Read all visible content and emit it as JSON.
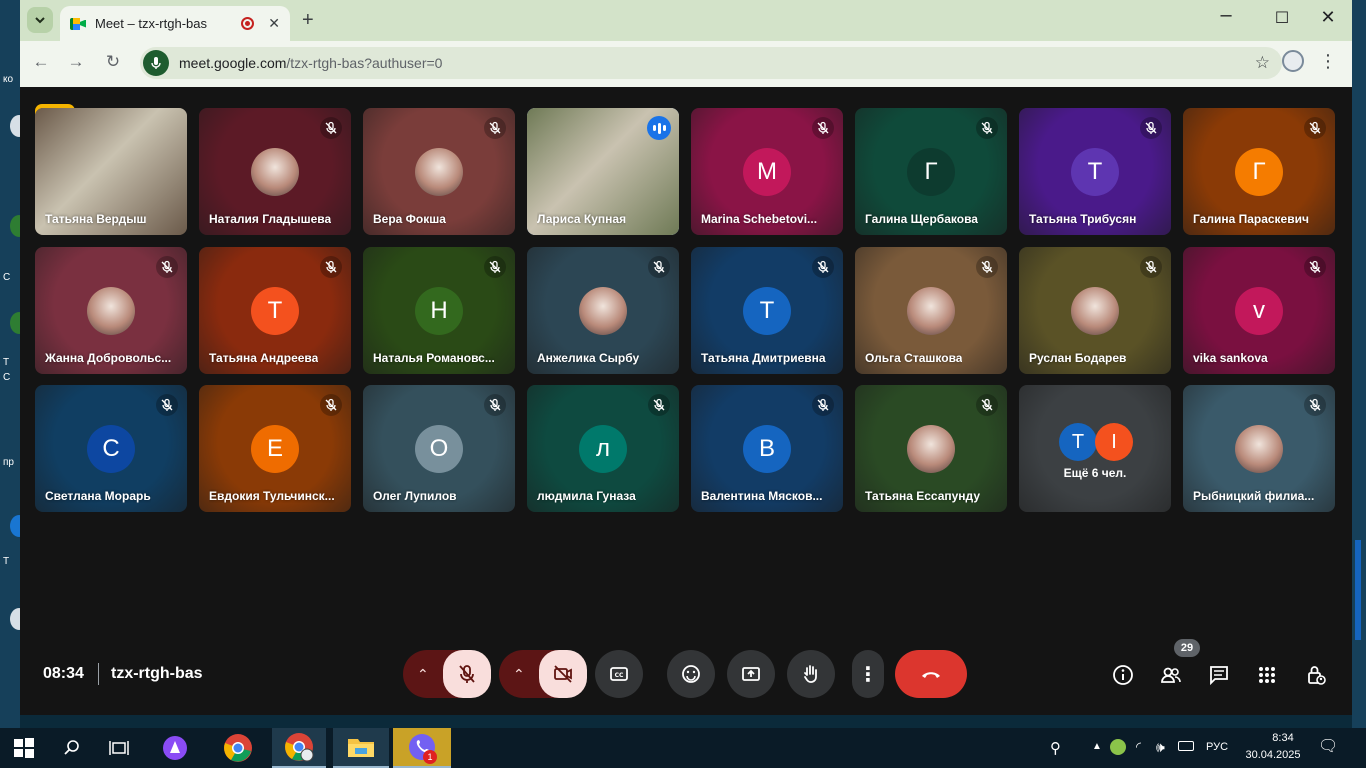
{
  "browser": {
    "tab_title": "Meet – tzx-rtgh-bas",
    "url_host": "meet.google.com",
    "url_path": "/tzx-rtgh-bas?authuser=0"
  },
  "desktop_left": [
    "ко",
    "С",
    "Т",
    "С",
    "пр",
    "Т"
  ],
  "participants": [
    {
      "name": "Татьяна Вердыш",
      "avatar_type": "video",
      "color": "#6b5a4a",
      "mic": "none"
    },
    {
      "name": "Наталия Гладышева",
      "avatar_type": "photo",
      "color": "#5c1a26",
      "mic": "off"
    },
    {
      "name": "Вера Фокша",
      "avatar_type": "photo",
      "color": "#7a3d3a",
      "mic": "off"
    },
    {
      "name": "Лариса Купная",
      "avatar_type": "video",
      "color": "#6f7a56",
      "mic": "speaking"
    },
    {
      "name": "Marina Schebetovi...",
      "avatar_type": "letter",
      "letter": "M",
      "color": "#8a1446",
      "avatar_color": "#c2185b",
      "mic": "off"
    },
    {
      "name": "Галина Щербакова",
      "avatar_type": "letter",
      "letter": "Г",
      "color": "#0f4a3a",
      "avatar_color": "#0d3b2f",
      "mic": "off"
    },
    {
      "name": "Татьяна Трибусян",
      "avatar_type": "letter",
      "letter": "Т",
      "color": "#4a1a8a",
      "avatar_color": "#5e35b1",
      "mic": "off"
    },
    {
      "name": "Галина Параскевич",
      "avatar_type": "letter",
      "letter": "Г",
      "color": "#8a3a06",
      "avatar_color": "#f57c00",
      "mic": "off"
    },
    {
      "name": "Жанна Добровольс...",
      "avatar_type": "photo",
      "color": "#7a3040",
      "mic": "off"
    },
    {
      "name": "Татьяна Андреева",
      "avatar_type": "letter",
      "letter": "Т",
      "color": "#8a2a0e",
      "avatar_color": "#f4511e",
      "mic": "off"
    },
    {
      "name": "Наталья Романовс...",
      "avatar_type": "letter",
      "letter": "Н",
      "color": "#2a4a16",
      "avatar_color": "#33691e",
      "mic": "off"
    },
    {
      "name": "Анжелика Сырбу",
      "avatar_type": "photo",
      "color": "#2c4654",
      "mic": "off"
    },
    {
      "name": "Татьяна Дмитриевна",
      "avatar_type": "letter",
      "letter": "Т",
      "color": "#123c66",
      "avatar_color": "#1565c0",
      "mic": "off"
    },
    {
      "name": "Ольга Сташкова",
      "avatar_type": "photo",
      "color": "#7a5a3a",
      "mic": "off"
    },
    {
      "name": "Руслан Бодарев",
      "avatar_type": "photo",
      "color": "#5a5226",
      "mic": "off"
    },
    {
      "name": "vika sankova",
      "avatar_type": "letter",
      "letter": "v",
      "color": "#7a1040",
      "avatar_color": "#c2185b",
      "mic": "off"
    },
    {
      "name": "Светлана Морарь",
      "avatar_type": "letter",
      "letter": "С",
      "color": "#103e62",
      "avatar_color": "#0d47a1",
      "mic": "off"
    },
    {
      "name": "Евдокия Тульчинск...",
      "avatar_type": "letter",
      "letter": "Е",
      "color": "#8a3a06",
      "avatar_color": "#ef6c00",
      "mic": "off"
    },
    {
      "name": "Олег Лупилов",
      "avatar_type": "letter",
      "letter": "О",
      "color": "#34505c",
      "avatar_color": "#78909c",
      "mic": "off"
    },
    {
      "name": "людмила Гуназа",
      "avatar_type": "letter",
      "letter": "л",
      "color": "#0e4a40",
      "avatar_color": "#00796b",
      "mic": "off"
    },
    {
      "name": "Валентина Мясков...",
      "avatar_type": "letter",
      "letter": "В",
      "color": "#123c66",
      "avatar_color": "#1565c0",
      "mic": "off"
    },
    {
      "name": "Татьяна Ессапунду",
      "avatar_type": "photo",
      "color": "#2a4a24",
      "mic": "off"
    },
    {
      "name": "",
      "avatar_type": "more",
      "color": "#3c4043",
      "mic": "none"
    },
    {
      "name": "Рыбницкий филиа...",
      "avatar_type": "photo",
      "color": "#3a5a6a",
      "mic": "off"
    }
  ],
  "more_tile": {
    "label": "Ещё 6 чел.",
    "letters": [
      "Т",
      "I"
    ],
    "colors": [
      "#1565c0",
      "#f4511e"
    ]
  },
  "bottom_bar": {
    "time": "08:34",
    "code": "tzx-rtgh-bas",
    "participants_count": "29"
  },
  "taskbar": {
    "time": "8:34",
    "date": "30.04.2025",
    "language": "РУС",
    "viber_badge": "1"
  },
  "colors": {
    "accent_blue": "#8ab4f8",
    "end_call": "#dc362e",
    "host_badge": "#f5b400"
  }
}
